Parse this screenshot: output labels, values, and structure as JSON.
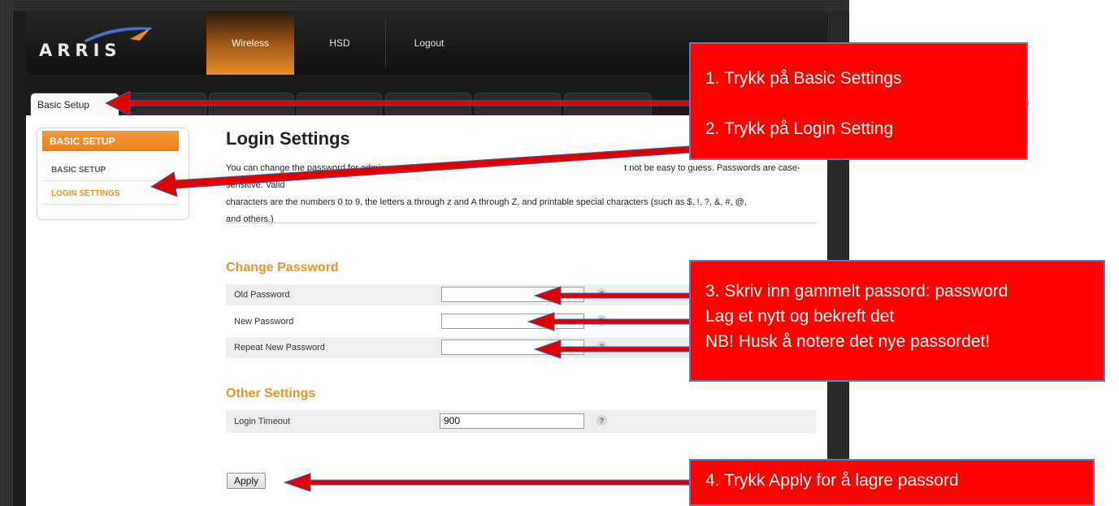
{
  "app": {
    "logo_text": "ARRIS"
  },
  "nav": {
    "tabs": [
      "Wireless",
      "HSD",
      "Logout"
    ],
    "active": "Wireless"
  },
  "subnav": {
    "active_tab": "Basic Setup"
  },
  "sidebar": {
    "header": "BASIC SETUP",
    "items": [
      "BASIC SETUP",
      "LOGIN SETTINGS"
    ],
    "active_item": "LOGIN SETTINGS"
  },
  "main": {
    "title": "Login Settings",
    "description": [
      "You can change the password for admin acco",
      "t not be easy to guess. Passwords are case-sensitive. Valid",
      "characters are the numbers 0 to 9, the letters a through z and A through Z, and printable special characters (such as $, !, ?, &, #, @,",
      "and others.)"
    ],
    "change_password": {
      "heading": "Change Password",
      "fields": [
        {
          "label": "Old Password",
          "value": ""
        },
        {
          "label": "New Password",
          "value": ""
        },
        {
          "label": "Repeat New Password",
          "value": ""
        }
      ]
    },
    "other_settings": {
      "heading": "Other Settings",
      "fields": [
        {
          "label": "Login Timeout",
          "value": "900"
        }
      ]
    },
    "help_glyph": "?",
    "apply_label": "Apply"
  },
  "callouts": {
    "step1": "1. Trykk på Basic Settings",
    "step2": "2. Trykk på Login Setting",
    "step3": [
      "3. Skriv inn gammelt passord: password",
      "Lag et nytt og bekreft det",
      "NB! Husk å notere det nye passordet!"
    ],
    "step4": "4. Trykk Apply for å lagre passord"
  },
  "colors": {
    "accent_orange": "#e8922a",
    "callout_red": "#ff0000",
    "callout_border": "#5b7fbf"
  }
}
